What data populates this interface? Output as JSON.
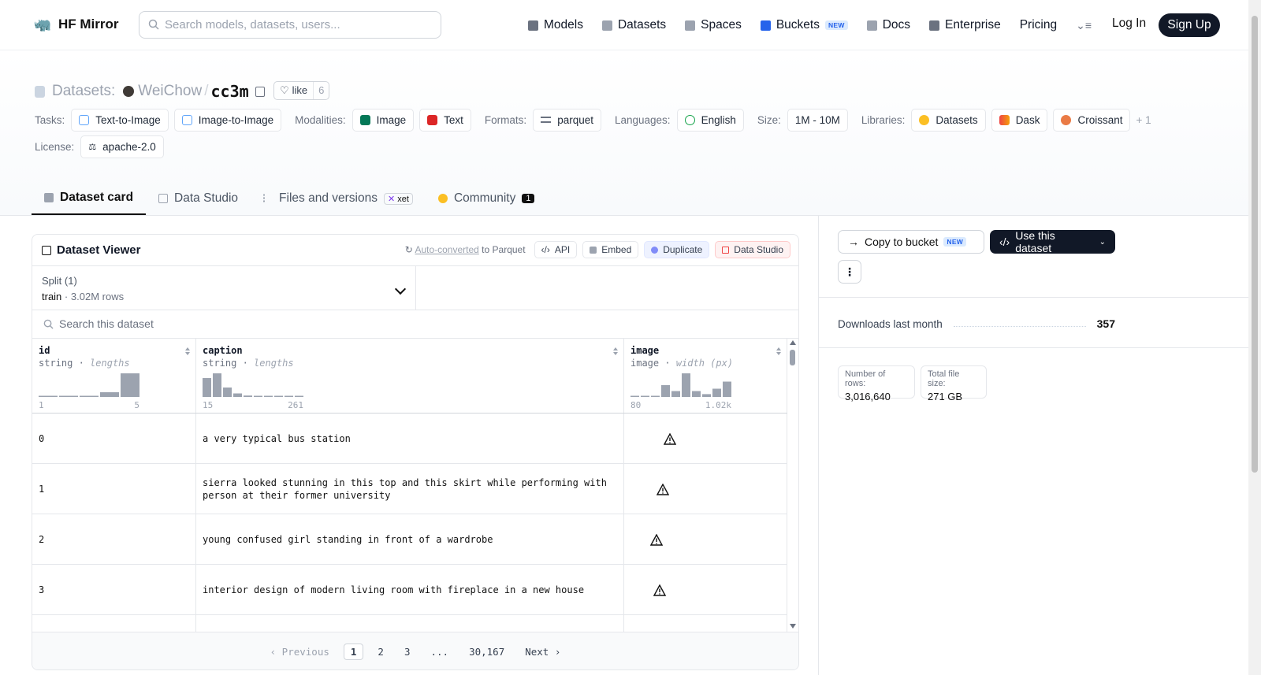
{
  "header": {
    "brand": "HF Mirror",
    "search_placeholder": "Search models, datasets, users...",
    "nav": [
      {
        "label": "Models",
        "icon": "cube-icon",
        "color": "#6b7280"
      },
      {
        "label": "Datasets",
        "icon": "database-icon",
        "color": "#9ca3af"
      },
      {
        "label": "Spaces",
        "icon": "grid-icon",
        "color": "#9ca3af"
      },
      {
        "label": "Buckets",
        "icon": "bucket-icon",
        "color": "#2563eb",
        "badge": "NEW"
      },
      {
        "label": "Docs",
        "icon": "book-icon",
        "color": "#9ca3af"
      },
      {
        "label": "Enterprise",
        "icon": "building-icon",
        "color": "#6b7280"
      },
      {
        "label": "Pricing"
      }
    ],
    "login": "Log In",
    "signup": "Sign Up"
  },
  "dataset": {
    "section_label": "Datasets:",
    "owner": "WeiChow",
    "name": "cc3m",
    "like_label": "like",
    "like_count": "6"
  },
  "meta": {
    "tasks_label": "Tasks:",
    "tasks": [
      "Text-to-Image",
      "Image-to-Image"
    ],
    "modalities_label": "Modalities:",
    "modalities": [
      "Image",
      "Text"
    ],
    "formats_label": "Formats:",
    "formats": [
      "parquet"
    ],
    "languages_label": "Languages:",
    "languages": [
      "English"
    ],
    "size_label": "Size:",
    "size": "1M - 10M",
    "libraries_label": "Libraries:",
    "libraries": [
      "Datasets",
      "Dask",
      "Croissant"
    ],
    "libraries_more": "+ 1",
    "license_label": "License:",
    "license": "apache-2.0"
  },
  "tabs": [
    {
      "label": "Dataset card",
      "active": true
    },
    {
      "label": "Data Studio"
    },
    {
      "label": "Files and versions",
      "badge": "xet"
    },
    {
      "label": "Community",
      "count": "1"
    }
  ],
  "viewer": {
    "title": "Dataset Viewer",
    "auto_converted": "Auto-converted",
    "to_parquet": "to Parquet",
    "actions": [
      "API",
      "Embed",
      "Duplicate",
      "Data Studio"
    ],
    "split_label": "Split (1)",
    "split_name": "train",
    "split_rows": "3.02M rows",
    "search_placeholder": "Search this dataset",
    "columns": [
      {
        "name": "id",
        "type": "string",
        "stat": "lengths",
        "min": "1",
        "max": "5",
        "hist": [
          0.04,
          0.04,
          0.04,
          0.2,
          1.0
        ]
      },
      {
        "name": "caption",
        "type": "string",
        "stat": "lengths",
        "min": "15",
        "max": "261",
        "hist": [
          0.8,
          1.0,
          0.4,
          0.15,
          0.06,
          0.04,
          0.03,
          0.03,
          0.03,
          0.03
        ]
      },
      {
        "name": "image",
        "type": "image",
        "stat": "width (px)",
        "min": "80",
        "max": "1.02k",
        "hist": [
          0.04,
          0.04,
          0.04,
          0.5,
          0.25,
          1.0,
          0.25,
          0.12,
          0.35,
          0.65
        ]
      }
    ],
    "rows": [
      {
        "id": "0",
        "caption": "a very typical bus station"
      },
      {
        "id": "1",
        "caption": "sierra looked stunning in this top and this skirt while performing with person at their former university"
      },
      {
        "id": "2",
        "caption": "young confused girl standing in front of a wardrobe"
      },
      {
        "id": "3",
        "caption": "interior design of modern living room with fireplace in a new house"
      },
      {
        "id": "",
        "caption": ""
      }
    ],
    "pager": {
      "prev": "Previous",
      "pages": [
        "1",
        "2",
        "3",
        "...",
        "30,167"
      ],
      "current": "1",
      "next": "Next"
    }
  },
  "sidebar": {
    "copy_to_bucket": "Copy to bucket",
    "copy_badge": "NEW",
    "use_dataset": "Use this dataset",
    "downloads_label": "Downloads last month",
    "downloads_value": "357",
    "rows_label": "Number of rows:",
    "rows_value": "3,016,640",
    "size_label": "Total file size:",
    "size_value": "271 GB"
  }
}
